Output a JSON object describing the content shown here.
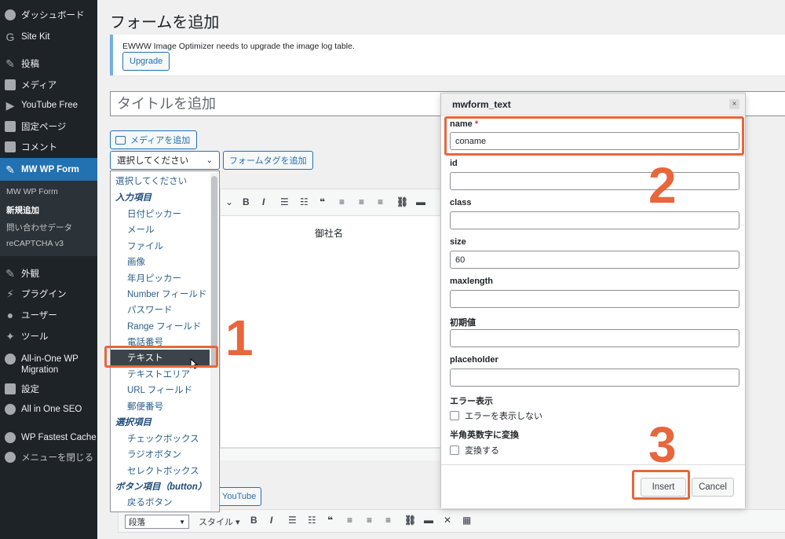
{
  "sidebar": {
    "items": [
      {
        "label": "ダッシュボード",
        "icon": "dashboard-icon"
      },
      {
        "label": "Site Kit",
        "icon": "google-g-icon"
      },
      {
        "label": "投稿",
        "icon": "pin-icon"
      },
      {
        "label": "メディア",
        "icon": "media-icon"
      },
      {
        "label": "YouTube Free",
        "icon": "youtube-icon"
      },
      {
        "label": "固定ページ",
        "icon": "page-icon"
      },
      {
        "label": "コメント",
        "icon": "comment-icon"
      },
      {
        "label": "MW WP Form",
        "icon": "pin-icon"
      },
      {
        "label": "外観",
        "icon": "appearance-icon"
      },
      {
        "label": "プラグイン",
        "icon": "plugin-icon"
      },
      {
        "label": "ユーザー",
        "icon": "user-icon"
      },
      {
        "label": "ツール",
        "icon": "tools-icon"
      },
      {
        "label": "All-in-One WP Migration",
        "icon": "migration-icon"
      },
      {
        "label": "設定",
        "icon": "settings-icon"
      },
      {
        "label": "All in One SEO",
        "icon": "seo-icon"
      },
      {
        "label": "WP Fastest Cache",
        "icon": "cache-icon"
      },
      {
        "label": "メニューを閉じる",
        "icon": "collapse-icon"
      }
    ],
    "submenu": [
      "MW WP Form",
      "新規追加",
      "問い合わせデータ",
      "reCAPTCHA v3"
    ]
  },
  "main": {
    "page_title": "フォームを追加",
    "notice_text": "EWWW Image Optimizer needs to upgrade the image log table.",
    "upgrade_label": "Upgrade",
    "title_placeholder": "タイトルを追加",
    "media_button": "メディアを追加",
    "select_value": "選択してください",
    "formtag_button": "フォームタグを追加",
    "editor_text": "御社名",
    "youtube_button": "YouTube",
    "format_select": "段落",
    "style_label": "スタイル"
  },
  "dropdown": {
    "items": [
      {
        "label": "選択してください",
        "type": "first"
      },
      {
        "label": "入力項目",
        "type": "group"
      },
      {
        "label": "日付ピッカー",
        "type": "option"
      },
      {
        "label": "メール",
        "type": "option"
      },
      {
        "label": "ファイル",
        "type": "option"
      },
      {
        "label": "画像",
        "type": "option"
      },
      {
        "label": "年月ピッカー",
        "type": "option"
      },
      {
        "label": "Number フィールド",
        "type": "option"
      },
      {
        "label": "パスワード",
        "type": "option"
      },
      {
        "label": "Range フィールド",
        "type": "option"
      },
      {
        "label": "電話番号",
        "type": "option"
      },
      {
        "label": "テキスト",
        "type": "selected"
      },
      {
        "label": "テキストエリア",
        "type": "option"
      },
      {
        "label": "URL フィールド",
        "type": "option"
      },
      {
        "label": "郵便番号",
        "type": "option"
      },
      {
        "label": "選択項目",
        "type": "group"
      },
      {
        "label": "チェックボックス",
        "type": "option"
      },
      {
        "label": "ラジオボタン",
        "type": "option"
      },
      {
        "label": "セレクトボックス",
        "type": "option"
      },
      {
        "label": "ボタン項目（button）",
        "type": "group"
      },
      {
        "label": "戻るボタン",
        "type": "option"
      }
    ]
  },
  "dialog": {
    "title": "mwform_text",
    "close": "×",
    "fields": {
      "name_label": "name",
      "name_required": "*",
      "name_value": "coname",
      "id_label": "id",
      "class_label": "class",
      "size_label": "size",
      "size_value": "60",
      "maxlength_label": "maxlength",
      "initial_label": "初期値",
      "placeholder_label": "placeholder"
    },
    "error_section": "エラー表示",
    "error_checkbox": "エラーを表示しない",
    "convert_section": "半角英数字に変換",
    "convert_checkbox": "変換する",
    "insert_label": "Insert",
    "cancel_label": "Cancel"
  },
  "annotations": {
    "step1": "1",
    "step2": "2",
    "step3": "3",
    "color": "#e8663c"
  }
}
